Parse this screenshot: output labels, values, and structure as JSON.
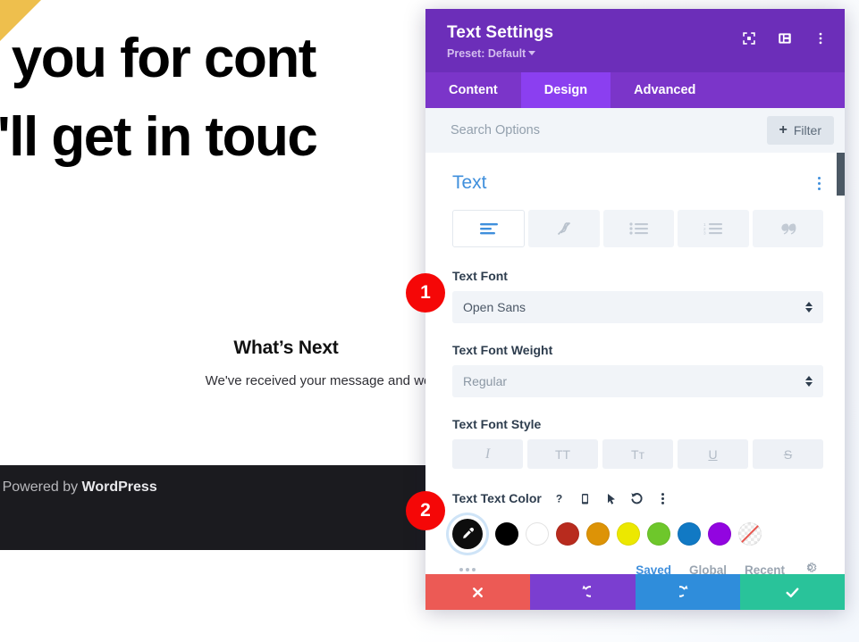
{
  "background_page": {
    "hero_lines": [
      "k you for cont",
      "e'll get in touc"
    ],
    "whats_next_title": "What’s Next",
    "whats_next_body": "We've received your message and we'll send you an email within",
    "footer_text_prefix": "| Powered by ",
    "footer_text_brand": "WordPress"
  },
  "panel": {
    "title": "Text Settings",
    "preset": "Preset: Default",
    "header_icons": [
      {
        "name": "fullscreen-icon"
      },
      {
        "name": "layout-panel-icon"
      },
      {
        "name": "more-vertical-icon"
      }
    ],
    "tabs": [
      {
        "label": "Content",
        "active": false
      },
      {
        "label": "Design",
        "active": true
      },
      {
        "label": "Advanced",
        "active": false
      }
    ],
    "search": {
      "placeholder": "Search Options",
      "value": "",
      "filter_label": "Filter"
    },
    "section": {
      "title": "Text",
      "align_buttons": [
        {
          "name": "text-align-left-icon",
          "active": true
        },
        {
          "name": "no-format-icon",
          "active": false
        },
        {
          "name": "unordered-list-icon",
          "active": false
        },
        {
          "name": "ordered-list-icon",
          "active": false
        },
        {
          "name": "blockquote-icon",
          "active": false
        }
      ],
      "text_font": {
        "label": "Text Font",
        "value": "Open Sans"
      },
      "text_font_weight": {
        "label": "Text Font Weight",
        "value": "Regular"
      },
      "text_font_style": {
        "label": "Text Font Style",
        "buttons": [
          {
            "name": "italic-button",
            "glyph": "I"
          },
          {
            "name": "uppercase-button",
            "glyph": "TT"
          },
          {
            "name": "capitalize-button",
            "glyph": "Tᴛ"
          },
          {
            "name": "underline-button",
            "glyph": "U"
          },
          {
            "name": "strikethrough-button",
            "glyph": "S"
          }
        ]
      },
      "text_color": {
        "label": "Text Text Color",
        "icons": [
          {
            "name": "help-icon",
            "glyph": "?"
          },
          {
            "name": "responsive-phone-icon",
            "glyph": "▯"
          },
          {
            "name": "hover-cursor-icon",
            "glyph": "➤"
          },
          {
            "name": "reset-icon",
            "glyph": "↺"
          },
          {
            "name": "more-vertical-icon",
            "glyph": "⋮"
          }
        ],
        "picker_name": "eyedropper-button",
        "swatches": [
          {
            "name": "swatch-black",
            "color": "#000000"
          },
          {
            "name": "swatch-white",
            "color": "#ffffff"
          },
          {
            "name": "swatch-brick-red",
            "color": "#b82b1e"
          },
          {
            "name": "swatch-amber",
            "color": "#dd9306"
          },
          {
            "name": "swatch-yellow",
            "color": "#ece800"
          },
          {
            "name": "swatch-green",
            "color": "#6ec72b"
          },
          {
            "name": "swatch-blue",
            "color": "#1179c4"
          },
          {
            "name": "swatch-purple",
            "color": "#9205e0"
          },
          {
            "name": "swatch-transparent",
            "color": "transparent"
          }
        ],
        "footer_tabs": [
          {
            "label": "Saved",
            "active": true
          },
          {
            "label": "Global",
            "active": false
          },
          {
            "label": "Recent",
            "active": false
          }
        ],
        "settings_icon": "gear-icon"
      }
    },
    "action_bar": [
      {
        "name": "cancel-button",
        "icon": "close-icon",
        "color": "#ec5a55"
      },
      {
        "name": "undo-button",
        "icon": "undo-icon",
        "color": "#7b3ed0"
      },
      {
        "name": "redo-button",
        "icon": "redo-icon",
        "color": "#2f8ddb"
      },
      {
        "name": "save-button",
        "icon": "check-icon",
        "color": "#29c39a"
      }
    ]
  },
  "step_badges": [
    {
      "label": "1"
    },
    {
      "label": "2"
    }
  ]
}
